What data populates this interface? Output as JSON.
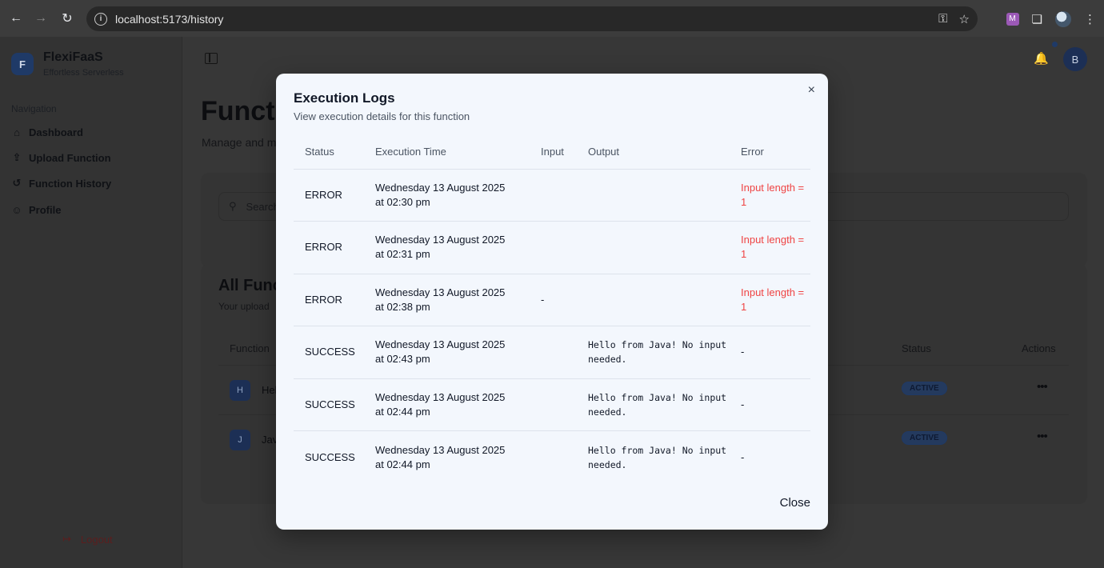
{
  "browser": {
    "url": "localhost:5173/history",
    "ext_badge": "M"
  },
  "sidebar": {
    "brand_initial": "F",
    "brand_title": "FlexiFaaS",
    "brand_sub": "Effortless Serverless",
    "nav_label": "Navigation",
    "items": [
      {
        "label": "Dashboard"
      },
      {
        "label": "Upload Function"
      },
      {
        "label": "Function History"
      },
      {
        "label": "Profile"
      }
    ],
    "logout_label": "Logout"
  },
  "topbar": {
    "user_initial": "B"
  },
  "page": {
    "title": "Functi",
    "subtitle": "Manage and m",
    "search_placeholder": "Search",
    "list_title": "All Func",
    "list_subtitle": "Your upload",
    "columns": {
      "function": "Function",
      "status": "Status",
      "actions": "Actions"
    },
    "rows": [
      {
        "initial": "H",
        "name": "Hel",
        "status": "ACTIVE"
      },
      {
        "initial": "J",
        "name": "Jav",
        "status": "ACTIVE"
      }
    ]
  },
  "modal": {
    "title": "Execution Logs",
    "subtitle": "View execution details for this function",
    "headers": [
      "Status",
      "Execution Time",
      "Input",
      "Output",
      "Error"
    ],
    "logs": [
      {
        "status": "ERROR",
        "time_line1": "Wednesday 13 August 2025",
        "time_line2": "at 02:30 pm",
        "input": "",
        "output": "",
        "error": "Input length = 1"
      },
      {
        "status": "ERROR",
        "time_line1": "Wednesday 13 August 2025",
        "time_line2": "at 02:31 pm",
        "input": "",
        "output": "",
        "error": "Input length = 1"
      },
      {
        "status": "ERROR",
        "time_line1": "Wednesday 13 August 2025",
        "time_line2": "at 02:38 pm",
        "input": "-",
        "output": "",
        "error": "Input length = 1"
      },
      {
        "status": "SUCCESS",
        "time_line1": "Wednesday 13 August 2025",
        "time_line2": "at 02:43 pm",
        "input": "",
        "output": "Hello from Java! No input needed.",
        "error": "-"
      },
      {
        "status": "SUCCESS",
        "time_line1": "Wednesday 13 August 2025",
        "time_line2": "at 02:44 pm",
        "input": "",
        "output": "Hello from Java! No input needed.",
        "error": "-"
      },
      {
        "status": "SUCCESS",
        "time_line1": "Wednesday 13 August 2025",
        "time_line2": "at 02:44 pm",
        "input": "",
        "output": "Hello from Java! No input needed.",
        "error": "-"
      }
    ],
    "close_label": "Close",
    "close_icon": "×"
  },
  "colors": {
    "error_text": "#ef4444",
    "accent": "#1f3a67"
  }
}
